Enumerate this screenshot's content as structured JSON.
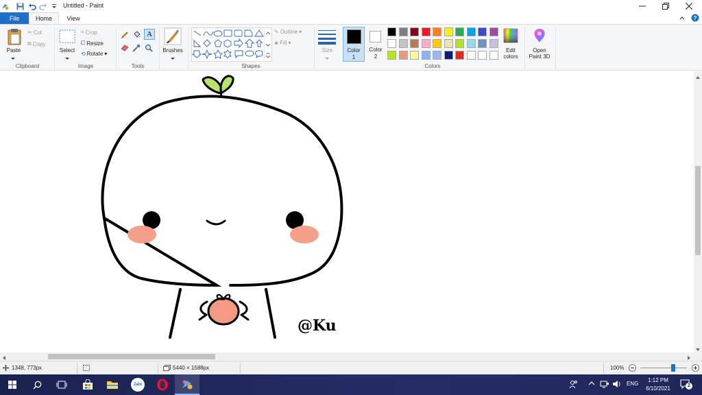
{
  "window": {
    "title": "Untitled - Paint",
    "controls": [
      "minimize",
      "restore",
      "close"
    ]
  },
  "quick_access": [
    "paint-app-icon",
    "save-icon",
    "undo-icon",
    "redo-icon",
    "customize-qat-icon"
  ],
  "tabs": {
    "file": "File",
    "home": "Home",
    "view": "View"
  },
  "ribbon": {
    "clipboard": {
      "label": "Clipboard",
      "paste": "Paste",
      "cut": "Cut",
      "copy": "Copy"
    },
    "image": {
      "label": "Image",
      "select": "Select",
      "crop": "Crop",
      "resize": "Resize",
      "rotate": "Rotate"
    },
    "tools": {
      "label": "Tools"
    },
    "brushes": {
      "label": "Brushes"
    },
    "shapes": {
      "label": "Shapes",
      "outline": "Outline",
      "fill": "Fill"
    },
    "size": {
      "label": "Size"
    },
    "color1": {
      "label": "Color",
      "num": "1",
      "value": "#000000"
    },
    "color2": {
      "label": "Color",
      "num": "2",
      "value": "#ffffff"
    },
    "colors": {
      "label": "Colors",
      "edit_label": "Edit",
      "edit_label2": "colors",
      "palette": [
        [
          "#000000",
          "#7f7f7f",
          "#880015",
          "#ed1c24",
          "#ff7f27",
          "#fff200",
          "#22b14c",
          "#00a2e8",
          "#3f48cc",
          "#a349a4"
        ],
        [
          "#ffffff",
          "#c3c3c3",
          "#b97a57",
          "#ffaec9",
          "#ffc90e",
          "#efe4b0",
          "#b5e61d",
          "#99d9ea",
          "#7092be",
          "#c8bfe7"
        ],
        [
          "#b5e61d",
          "#f0987a",
          "#fff59a",
          "#8fb0f7",
          "#9bb6f0",
          "#0b1f78",
          "#e8261c",
          "#ffffff",
          "#ffffff",
          "#ffffff"
        ]
      ]
    },
    "paint3d": {
      "label": "Open",
      "label2": "Paint 3D"
    }
  },
  "canvas": {
    "signature": "@Ku",
    "colors": {
      "outline": "#000000",
      "blush": "#f4a08a",
      "peach": "#f49a84",
      "sprout": "#b8e36a"
    }
  },
  "status": {
    "cursor_pos": "1348, 773px",
    "image_size": "5440 × 1588px",
    "zoom": "100%",
    "zoom_fraction": 0.7
  },
  "taskbar": {
    "apps": [
      "start-icon",
      "search-icon",
      "task-view-icon",
      "store-icon",
      "file-explorer-icon",
      "zalo-icon",
      "opera-icon",
      "paint-icon"
    ],
    "zalo": "Zalo",
    "lang": "ENG",
    "time": "1:12 PM",
    "date": "6/10/2021",
    "notifications": "2"
  }
}
